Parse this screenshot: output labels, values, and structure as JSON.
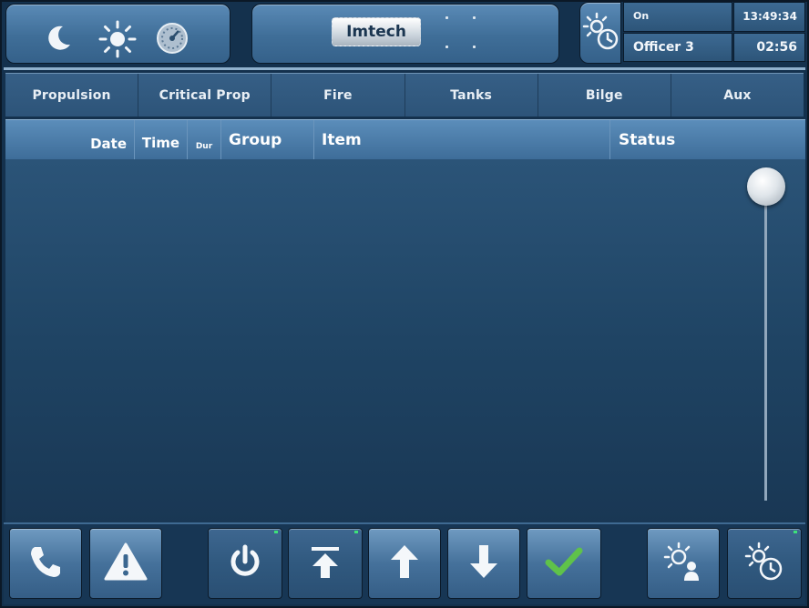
{
  "header": {
    "night_mode_icon": "moon-icon",
    "day_mode_icon": "sun-icon",
    "dimmer_icon": "gauge-icon",
    "logo_text": "Imtech",
    "watch_icon": "sun-clock-icon",
    "watch_state": "On",
    "clock_time": "13:49:34",
    "officer": "Officer 3",
    "watch_duration": "02:56"
  },
  "tabs": [
    {
      "label": "Propulsion"
    },
    {
      "label": "Critical Prop"
    },
    {
      "label": "Fire"
    },
    {
      "label": "Tanks"
    },
    {
      "label": "Bilge"
    },
    {
      "label": "Aux"
    }
  ],
  "table": {
    "columns": {
      "date": "Date",
      "time": "Time",
      "dur": "Dur",
      "group": "Group",
      "item": "Item",
      "status": "Status"
    },
    "rows": []
  },
  "toolbar": {
    "buttons": [
      {
        "name": "phone-button",
        "icon": "phone-icon"
      },
      {
        "name": "alarm-button",
        "icon": "warning-icon"
      },
      {
        "name": "power-button",
        "icon": "power-icon"
      },
      {
        "name": "scroll-top-button",
        "icon": "arrow-to-top-icon"
      },
      {
        "name": "scroll-up-button",
        "icon": "arrow-up-icon"
      },
      {
        "name": "scroll-down-button",
        "icon": "arrow-down-icon"
      },
      {
        "name": "acknowledge-button",
        "icon": "check-icon"
      },
      {
        "name": "bridge-watch-button",
        "icon": "sun-person-icon"
      },
      {
        "name": "watch-timer-button",
        "icon": "sun-clock-icon"
      }
    ]
  },
  "colors": {
    "accent_green": "#5fc24a",
    "led_green": "#3ee27a",
    "panel_blue": "#3f6e98"
  }
}
